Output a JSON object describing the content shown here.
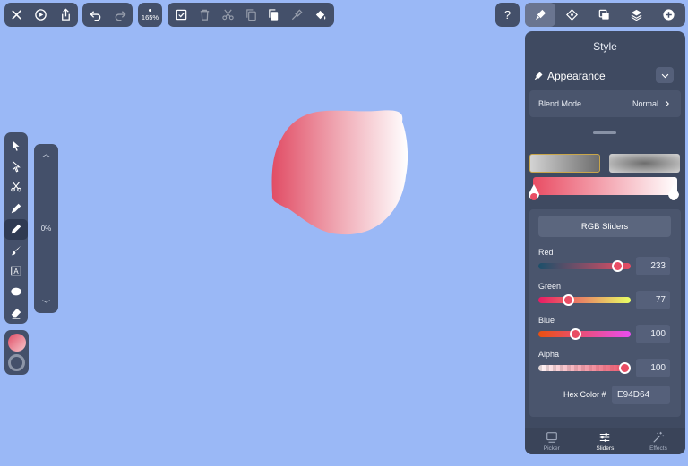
{
  "toolbar": {
    "zoom_label": "165%"
  },
  "left_panel": {
    "opacity_label": "0%"
  },
  "style_panel": {
    "title": "Style",
    "appearance_label": "Appearance",
    "blend_mode_label": "Blend Mode",
    "blend_mode_value": "Normal",
    "rgb_button_label": "RGB Sliders",
    "sliders": [
      {
        "name": "Red",
        "value": "233",
        "fraction": 0.914
      },
      {
        "name": "Green",
        "value": "77",
        "fraction": 0.302
      },
      {
        "name": "Blue",
        "value": "100",
        "fraction": 0.392
      },
      {
        "name": "Alpha",
        "value": "100",
        "fraction": 1.0
      }
    ],
    "hex_label": "Hex Color #",
    "hex_value": "E94D64",
    "tabs": [
      {
        "label": "Picker",
        "active": false
      },
      {
        "label": "Sliders",
        "active": true
      },
      {
        "label": "Effects",
        "active": false
      }
    ]
  },
  "colors": {
    "canvas_background": "#9ab8f6",
    "fill_start": "#e94d64",
    "fill_end": "#ffffff"
  }
}
